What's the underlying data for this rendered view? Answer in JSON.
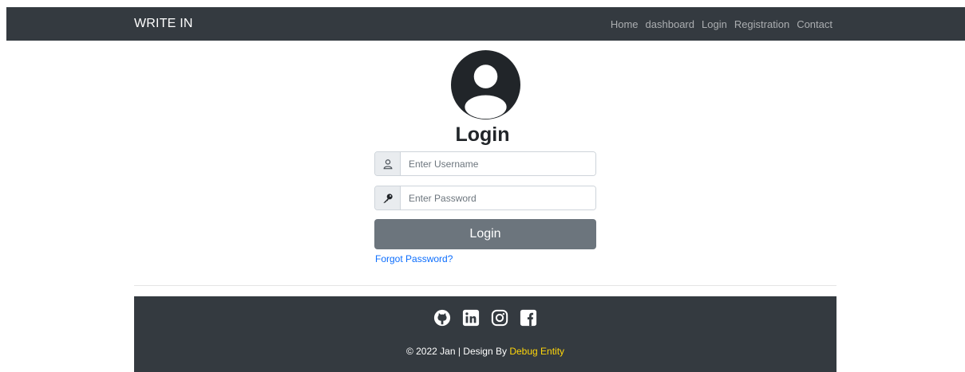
{
  "navbar": {
    "brand": "WRITE IN",
    "links": [
      "Home",
      "dashboard",
      "Login",
      "Registration",
      "Contact"
    ]
  },
  "login": {
    "title": "Login",
    "username_placeholder": "Enter Username",
    "password_placeholder": "Enter Password",
    "button_label": "Login",
    "forgot_link": "Forgot Password?"
  },
  "footer": {
    "social_icons": [
      "github-icon",
      "linkedin-icon",
      "instagram-icon",
      "facebook-icon"
    ],
    "copyright": "© 2022 Jan | Design By",
    "credit": "Debug Entity",
    "credit_color": "#ffd60a"
  },
  "colors": {
    "navbar": "#343a40",
    "button": "#6c757d",
    "link": "#0d6efd"
  }
}
